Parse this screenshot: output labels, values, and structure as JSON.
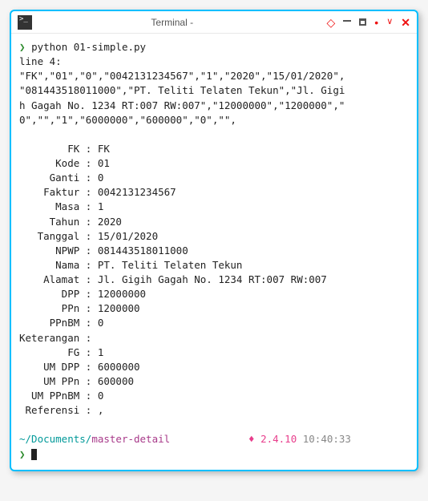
{
  "window": {
    "title": "Terminal -"
  },
  "prompt": {
    "symbol": "❯"
  },
  "cmd": "python 01-simple.py",
  "out": {
    "l1": "line 4:",
    "l2": "\"FK\",\"01\",\"0\",\"0042131234567\",\"1\",\"2020\",\"15/01/2020\",",
    "l3": "\"081443518011000\",\"PT. Teliti Telaten Tekun\",\"Jl. Gigi",
    "l4": "h Gagah No. 1234 RT:007 RW:007\",\"12000000\",\"1200000\",\"",
    "l5": "0\",\"\",\"1\",\"6000000\",\"600000\",\"0\",\"\","
  },
  "fields": {
    "f01": {
      "k": "        FK",
      "v": "FK"
    },
    "f02": {
      "k": "      Kode",
      "v": "01"
    },
    "f03": {
      "k": "     Ganti",
      "v": "0"
    },
    "f04": {
      "k": "    Faktur",
      "v": "0042131234567"
    },
    "f05": {
      "k": "      Masa",
      "v": "1"
    },
    "f06": {
      "k": "     Tahun",
      "v": "2020"
    },
    "f07": {
      "k": "   Tanggal",
      "v": "15/01/2020"
    },
    "f08": {
      "k": "      NPWP",
      "v": "081443518011000"
    },
    "f09": {
      "k": "      Nama",
      "v": "PT. Teliti Telaten Tekun"
    },
    "f10": {
      "k": "    Alamat",
      "v": "Jl. Gigih Gagah No. 1234 RT:007 RW:007"
    },
    "f11": {
      "k": "       DPP",
      "v": "12000000"
    },
    "f12": {
      "k": "       PPn",
      "v": "1200000"
    },
    "f13": {
      "k": "     PPnBM",
      "v": "0"
    },
    "f14": {
      "k": "Keterangan",
      "v": ""
    },
    "f15": {
      "k": "        FG",
      "v": "1"
    },
    "f16": {
      "k": "    UM DPP",
      "v": "6000000"
    },
    "f17": {
      "k": "    UM PPn",
      "v": "600000"
    },
    "f18": {
      "k": "  UM PPnBM",
      "v": "0"
    },
    "f19": {
      "k": " Referensi",
      "v": ","
    }
  },
  "status": {
    "path1": "~/Documents/",
    "path2": "master-detail",
    "ruby": "2.4.10",
    "time": "10:40:33"
  }
}
